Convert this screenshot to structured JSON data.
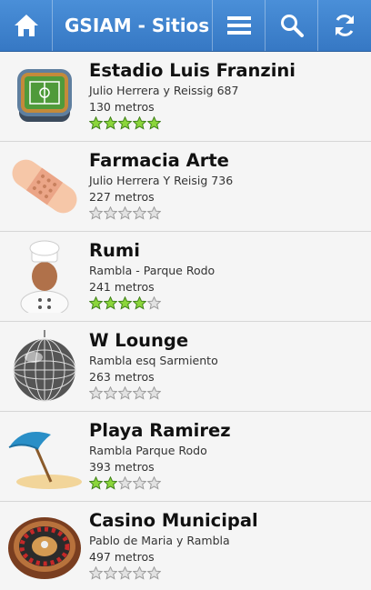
{
  "header": {
    "title": "GSIAM - Sitios",
    "icons": [
      "home-icon",
      "menu-icon",
      "search-icon",
      "refresh-icon"
    ]
  },
  "colors": {
    "header_bg": "#3a7dc9",
    "star_filled": "#8bd63a",
    "star_empty": "#e2e2e2",
    "row_bg": "#f5f5f5"
  },
  "places": [
    {
      "name": "Estadio Luis Franzini",
      "address": "Julio Herrera y Reissig 687",
      "distance": "130 metros",
      "rating": 5,
      "icon": "stadium-icon"
    },
    {
      "name": "Farmacia Arte",
      "address": "Julio Herrera Y Reisig 736",
      "distance": "227 metros",
      "rating": 0,
      "icon": "bandage-icon"
    },
    {
      "name": "Rumi",
      "address": "Rambla - Parque Rodo",
      "distance": "241 metros",
      "rating": 4,
      "icon": "chef-icon"
    },
    {
      "name": "W Lounge",
      "address": "Rambla esq Sarmiento",
      "distance": "263 metros",
      "rating": 0,
      "icon": "disco-ball-icon"
    },
    {
      "name": "Playa Ramirez",
      "address": "Rambla Parque Rodo",
      "distance": "393 metros",
      "rating": 2,
      "icon": "beach-umbrella-icon"
    },
    {
      "name": "Casino Municipal",
      "address": "Pablo de Maria y Rambla",
      "distance": "497 metros",
      "rating": 0,
      "icon": "roulette-icon"
    }
  ]
}
